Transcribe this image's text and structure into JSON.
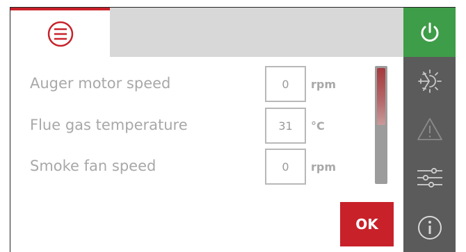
{
  "colors": {
    "accent": "#c8212a",
    "power_green": "#3e9d48",
    "sidebar": "#5b5b5b"
  },
  "header": {
    "menu_icon": "menu-circle-icon"
  },
  "sidebar": {
    "items": [
      {
        "icon": "power-icon"
      },
      {
        "icon": "sun-snowflake-icon"
      },
      {
        "icon": "warning-triangle-icon"
      },
      {
        "icon": "sliders-icon"
      },
      {
        "icon": "info-circle-icon"
      }
    ]
  },
  "parameters": [
    {
      "label": "Auger motor speed",
      "value": "0",
      "unit": "rpm"
    },
    {
      "label": "Flue gas temperature",
      "value": "31",
      "unit": "°C"
    },
    {
      "label": "Smoke fan speed",
      "value": "0",
      "unit": "rpm"
    }
  ],
  "scroll": {
    "position_fraction": 0.0,
    "visible_fraction": 0.5
  },
  "ok_button": {
    "label": "OK"
  }
}
